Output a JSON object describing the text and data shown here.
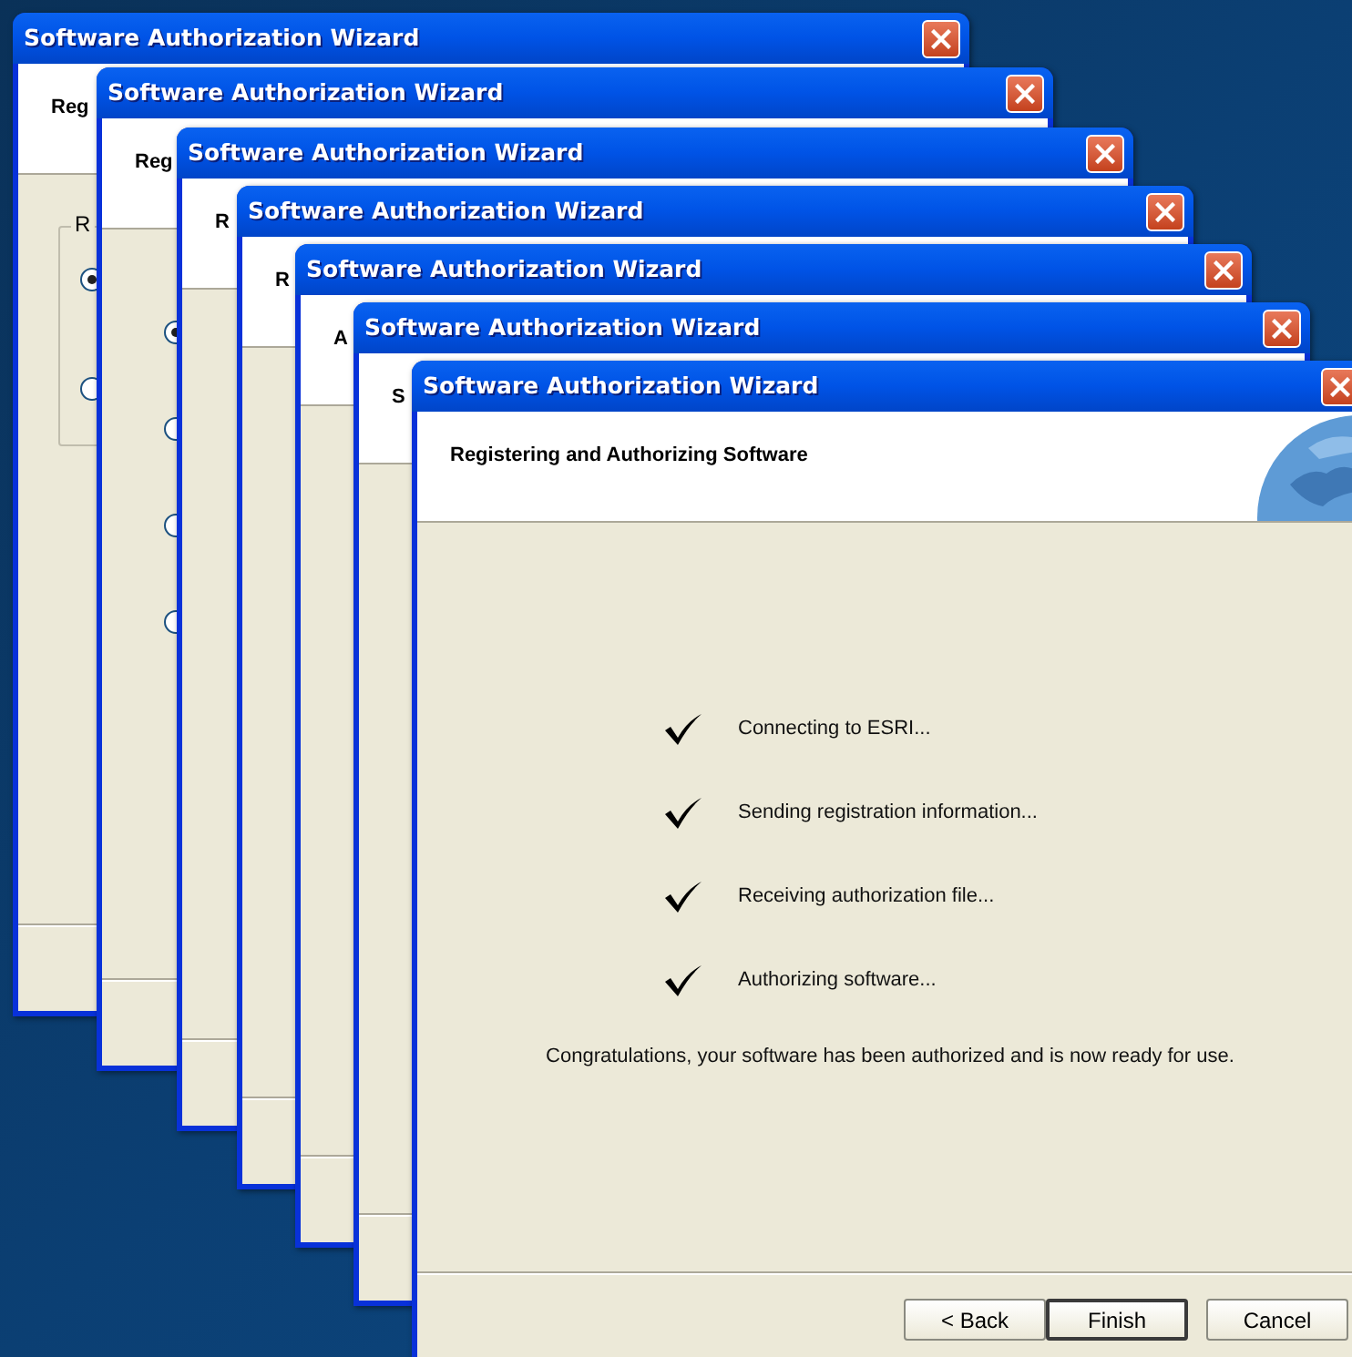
{
  "windows": [
    {
      "title": "Software Authorization Wizard",
      "heading": "Reg",
      "group": {
        "label": "R",
        "radios": [
          {
            "selected": true
          },
          {
            "selected": false
          }
        ]
      }
    },
    {
      "title": "Software Authorization Wizard",
      "heading": "Reg",
      "radios": [
        {
          "selected": true
        },
        {
          "selected": false
        },
        {
          "selected": false
        },
        {
          "selected": false
        }
      ]
    },
    {
      "title": "Software Authorization Wizard",
      "heading": "R"
    },
    {
      "title": "Software Authorization Wizard",
      "heading": "R"
    },
    {
      "title": "Software Authorization Wizard",
      "heading": "A"
    },
    {
      "title": "Software Authorization Wizard",
      "heading": "S"
    },
    {
      "title": "Software Authorization Wizard",
      "heading": "Registering and Authorizing Software",
      "steps": [
        {
          "label": "Connecting to ESRI...",
          "done": true
        },
        {
          "label": "Sending registration information...",
          "done": true
        },
        {
          "label": "Receiving authorization file...",
          "done": true
        },
        {
          "label": "Authorizing software...",
          "done": true
        }
      ],
      "message": "Congratulations, your software has been authorized and is now ready for use.",
      "buttons": [
        {
          "label": "< Back",
          "default": false
        },
        {
          "label": "Finish",
          "default": true
        },
        {
          "label": "Cancel",
          "default": false
        }
      ]
    }
  ]
}
